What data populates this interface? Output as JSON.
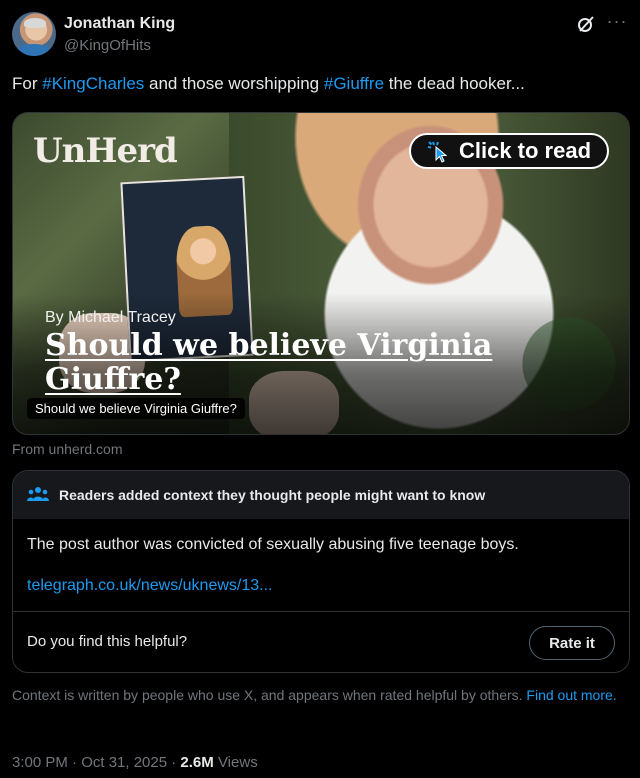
{
  "author": {
    "name": "Jonathan King",
    "handle": "@KingOfHits"
  },
  "tweet": {
    "text_parts": [
      "For ",
      "#KingCharles",
      " and those worshipping ",
      "#Giuffre",
      " the dead hooker..."
    ]
  },
  "card": {
    "logo": "UnHerd",
    "cta": "Click to read",
    "byline": "By Michael Tracey",
    "headline": "Should we believe Virginia Giuffre?",
    "caption": "Should we believe Virginia Giuffre?",
    "source": "From unherd.com"
  },
  "community_note": {
    "title": "Readers added context they thought people might want to know",
    "body": "The post author was convicted of sexually abusing five teenage boys.",
    "link": "telegraph.co.uk/news/uknews/13...",
    "helpful_question": "Do you find this helpful?",
    "rate_label": "Rate it",
    "footer_text": "Context is written by people who use X, and appears when rated helpful by others. ",
    "footer_link": "Find out more."
  },
  "meta": {
    "time": "3:00 PM · Oct 31, 2025 · ",
    "views_count": "2.6M",
    "views_label": " Views"
  },
  "colors": {
    "accent": "#1d9bf0",
    "muted": "#71767b",
    "border": "#2f3336"
  },
  "icons": [
    "grok-icon",
    "more-icon",
    "cursor-click-icon",
    "people-icon"
  ]
}
